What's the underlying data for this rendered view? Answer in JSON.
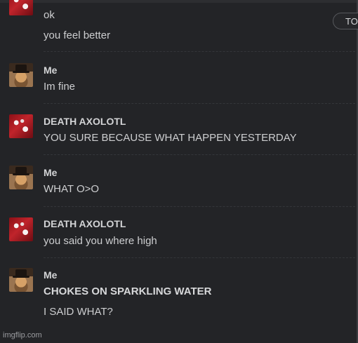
{
  "top_button_label": "TO",
  "watermark": "imgflip.com",
  "messages": [
    {
      "author": "",
      "avatar": "death-axolotl-avatar",
      "lines": [
        "ok",
        "you feel better"
      ]
    },
    {
      "author": "Me",
      "avatar": "me-avatar",
      "lines": [
        "Im fine"
      ]
    },
    {
      "author": "DEATH AXOLOTL",
      "avatar": "death-axolotl-avatar",
      "lines": [
        "YOU SURE BECAUSE WHAT HAPPEN YESTERDAY"
      ]
    },
    {
      "author": "Me",
      "avatar": "me-avatar",
      "lines": [
        "WHAT O>O"
      ]
    },
    {
      "author": "DEATH AXOLOTL",
      "avatar": "death-axolotl-avatar",
      "lines": [
        "you said you where high"
      ]
    },
    {
      "author": "Me",
      "avatar": "me-avatar",
      "lines": [
        "CHOKES ON SPARKLING WATER",
        "I SAID WHAT?"
      ]
    }
  ]
}
